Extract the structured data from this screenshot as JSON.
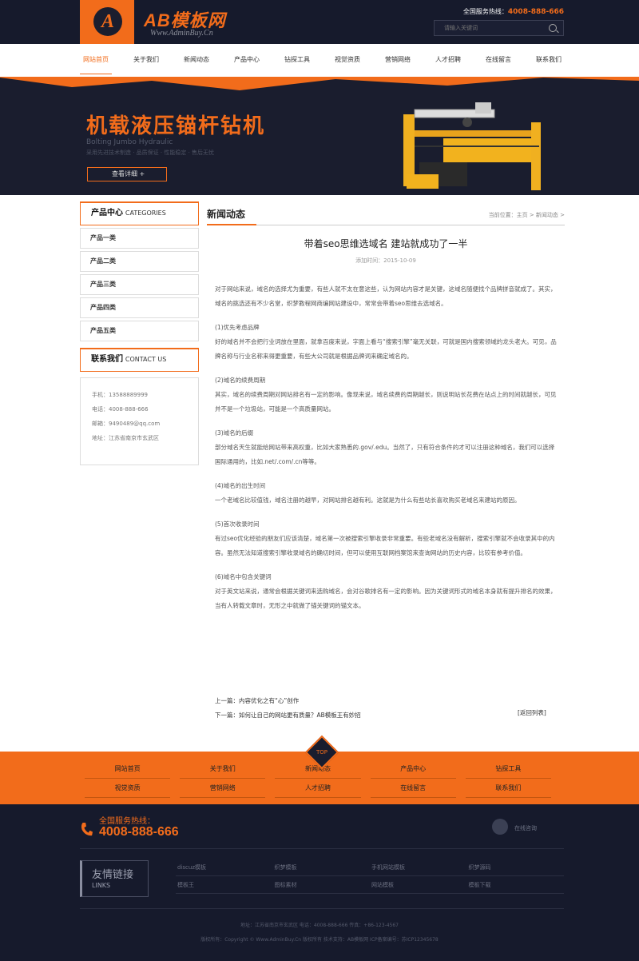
{
  "header": {
    "logo_letter": "A",
    "logo_text": "AB模板网",
    "logo_sub": "Www.AdminBuy.Cn",
    "hotline_label": "全国服务热线：",
    "hotline_number": "4008-888-666",
    "search_placeholder": "请输入关键词"
  },
  "nav": {
    "items": [
      "网站首页",
      "关于我们",
      "新闻动态",
      "产品中心",
      "钻探工具",
      "视觉资质",
      "营销网络",
      "人才招聘",
      "在线留言",
      "联系我们"
    ]
  },
  "banner": {
    "title": "机载液压锚杆钻机",
    "sub1": "Bolting Jumbo Hydraulic",
    "sub2": "采用先进技术制造 · 品质保证 · 性能稳定 · 售后无忧",
    "button": "查看详细 +"
  },
  "sidebar": {
    "products_title_cn": "产品中心",
    "products_title_en": "CATEGORIES",
    "products": [
      "产品一类",
      "产品二类",
      "产品三类",
      "产品四类",
      "产品五类"
    ],
    "contact_title_cn": "联系我们",
    "contact_title_en": "CONTACT US",
    "contact": [
      "手机：13588889999",
      "电话：4008-888-666",
      "邮箱：9490489@qq.com",
      "地址：江苏省南京市玄武区"
    ]
  },
  "main": {
    "heading": "新闻动态",
    "breadcrumb": "当前位置：主页 > 新闻动态 >",
    "article_title": "带着seo思维选域名 建站就成功了一半",
    "article_meta": "添加时间：2015-10-09",
    "paragraphs": [
      "对于网站来说，域名的选择尤为重要，有些人就不太在意这些，认为网站内容才是关键，这域名随便找个品牌拼音就成了。其实，域名的挑选还有不少名堂，织梦教程网商编网站建设中，常常会带着seo思维去选域名。",
      "(1)优先考虑品牌",
      "好的域名并不会把行业词放在里面，就拿百度来说，字面上看与“搜索引擎”毫无关联，可就是国内搜索领域的龙头老大。可见，品牌名称与行业名称来得更重要，有些大公司就是根据品牌词来确定域名的。",
      "(2)域名的续费周期",
      "其实，域名的续费周期对网站排名有一定的影响。像现来说，域名续费的周期越长，则说明站长花费在站点上的时间就越长，可见并不是一个垃圾站，可能是一个高质量网站。",
      "(3)域名的后缀",
      "部分域名天生就能给网站带来高权重，比如大家熟悉的.gov/.edu。当然了，只有符合条件的才可以注册这种域名，我们可以选择国际通用的，比如.net/.com/.cn等等。",
      "(4)域名的出生时间",
      "一个老域名比较值钱，域名注册的越早，对网站排名越有利。这就是为什么有些站长喜欢购买老域名来建站的原因。",
      "(5)首次收录时间",
      "有过seo优化经验的朋友们应该清楚，域名第一次被搜索引擎收录非常重要。有些老域名没有解析，搜索引擎就不会收录其中的内容。虽然无法知道搜索引擎收录域名的确切时间，但可以使用互联网档案馆来查询网站的历史内容，比较有参考价值。",
      "(6)域名中包含关键词",
      "对于英文站来说，通常会根据关键词来选购域名，会对谷歌排名有一定的影响。因为关键词形式的域名本身就有提升排名的效果，当有人转载文章时，无形之中就做了锚关键词的锚文本。"
    ],
    "prev": "上一篇：内容优化之有“心”创作",
    "next": "下一篇：如何让自己的网站更有质量？AB模板王有妙招",
    "back": "[返回列表]"
  },
  "footer_nav": {
    "top_label": "TOP",
    "items": [
      "网站首页",
      "关于我们",
      "新闻动态",
      "产品中心",
      "钻探工具",
      "视觉资质",
      "营销网络",
      "人才招聘",
      "在线留言",
      "联系我们"
    ]
  },
  "footer": {
    "tel_label": "全国服务热线：",
    "tel": "4008-888-666",
    "online": "在线咨询",
    "links_title": "友情链接",
    "links_en": "LINKS",
    "links": [
      "discuz模板",
      "织梦模板",
      "手机网站模板",
      "织梦源码",
      "模板王",
      "图标素材",
      "网站模板",
      "模板下载"
    ],
    "copy1": "地址：江苏省南京市玄武区    电话：4008-888-666    传真：+86-123-4567",
    "copy2": "版权所有：Copyright © Www.AdminBuy.Cn 版权所有    技术支持：AB模板网    ICP备案编号：苏ICP12345678"
  },
  "colors": {
    "accent": "#f26c1b",
    "dark": "#161a2c"
  }
}
